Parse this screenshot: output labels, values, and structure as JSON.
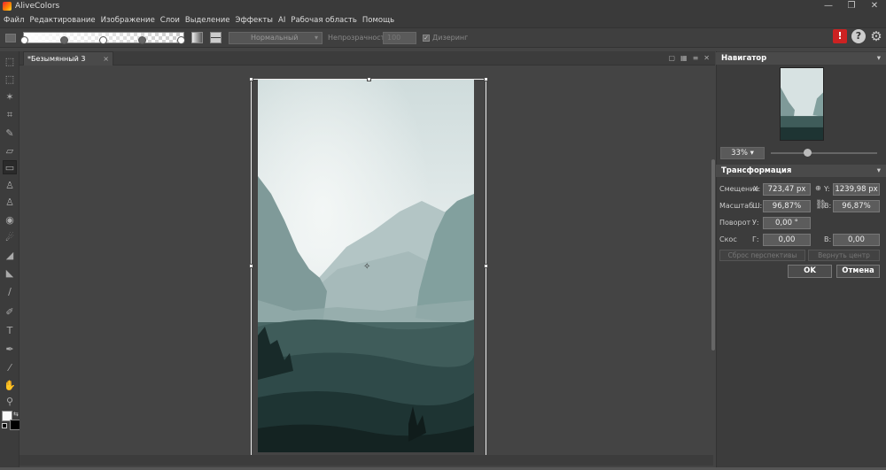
{
  "window": {
    "title": "AliveColors",
    "min": "—",
    "max": "❐",
    "close": "✕"
  },
  "menu": [
    "Файл",
    "Редактирование",
    "Изображение",
    "Слои",
    "Выделение",
    "Эффекты",
    "AI",
    "Рабочая область",
    "Помощь"
  ],
  "options": {
    "blend_mode": "Нормальный",
    "opacity_label": "Непрозрачность",
    "opacity_value": "100",
    "dither_label": "Дизеринг",
    "dither_check": "✓"
  },
  "top_icons": {
    "help": "?",
    "settings": "⚙",
    "alert": "!"
  },
  "document": {
    "tab_title": "*Безымянный 3",
    "close": "×"
  },
  "navigator": {
    "title": "Навигатор",
    "zoom": "33%"
  },
  "transform": {
    "title": "Трансформация",
    "offset_label": "Смещение",
    "x_label": "X:",
    "x_value": "723,47 px",
    "y_label": "Y:",
    "y_value": "1239,98 px",
    "scale_label": "Масштаб",
    "w_label": "Ш:",
    "w_value": "96,87%",
    "h_label": "В:",
    "h_value": "96,87%",
    "rotate_label": "Поворот",
    "u_label": "У:",
    "u_value": "0,00 °",
    "skew_label": "Скос",
    "g_label": "Г:",
    "g_value": "0,00",
    "v_label": "В:",
    "v_value": "0,00",
    "reset_perspective": "Сброс перспективы",
    "return_center": "Вернуть центр",
    "ok": "OK",
    "cancel": "Отмена"
  }
}
